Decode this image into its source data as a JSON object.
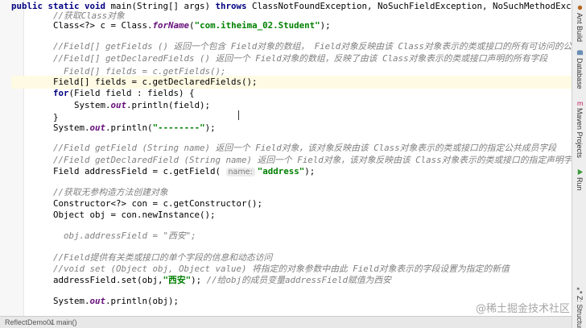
{
  "editor": {
    "lines": [
      {
        "hl": false,
        "indent": "",
        "tokens": [
          {
            "t": "public static void ",
            "c": "kw"
          },
          {
            "t": "main(String[] args) ",
            "c": ""
          },
          {
            "t": "throws ",
            "c": "kw"
          },
          {
            "t": "ClassNotFoundException, NoSuchFieldException, NoSuchMethodExce",
            "c": ""
          }
        ]
      },
      {
        "hl": false,
        "indent": "        ",
        "tokens": [
          {
            "t": "//获取Class对象",
            "c": "cm"
          }
        ]
      },
      {
        "hl": false,
        "indent": "        ",
        "tokens": [
          {
            "t": "Class<?> c = Class.",
            "c": ""
          },
          {
            "t": "forName",
            "c": "st"
          },
          {
            "t": "(",
            "c": ""
          },
          {
            "t": "\"com.itheima_02.Student\"",
            "c": "str"
          },
          {
            "t": ");",
            "c": ""
          }
        ]
      },
      {
        "hl": false,
        "indent": "",
        "tokens": []
      },
      {
        "hl": false,
        "indent": "        ",
        "tokens": [
          {
            "t": "//Field[] getFields () 返回一个包含 Field对象的数组， Field对象反映由该 Class对象表示的类或接口的所有可访问的公共",
            "c": "cm"
          }
        ]
      },
      {
        "hl": false,
        "indent": "        ",
        "tokens": [
          {
            "t": "//Field[] getDeclaredFields () 返回一个 Field对象的数组，反映了由该 Class对象表示的类或接口声明的所有字段",
            "c": "cm"
          }
        ]
      },
      {
        "hl": false,
        "indent": "          ",
        "tokens": [
          {
            "t": "Field[] fields = c.getFields();",
            "c": "cm"
          }
        ]
      },
      {
        "hl": true,
        "indent": "        ",
        "tokens": [
          {
            "t": "Field[] fields = c.getDeclaredFields();",
            "c": ""
          }
        ]
      },
      {
        "hl": false,
        "indent": "        ",
        "tokens": [
          {
            "t": "for",
            "c": "kw"
          },
          {
            "t": "(Field field : fields) {",
            "c": ""
          }
        ]
      },
      {
        "hl": false,
        "indent": "            ",
        "tokens": [
          {
            "t": "System.",
            "c": ""
          },
          {
            "t": "out",
            "c": "st"
          },
          {
            "t": ".println(field);",
            "c": ""
          }
        ]
      },
      {
        "hl": false,
        "indent": "        ",
        "tokens": [
          {
            "t": "}",
            "c": ""
          }
        ]
      },
      {
        "hl": false,
        "indent": "        ",
        "tokens": [
          {
            "t": "System.",
            "c": ""
          },
          {
            "t": "out",
            "c": "st"
          },
          {
            "t": ".println(",
            "c": ""
          },
          {
            "t": "\"--------\"",
            "c": "str"
          },
          {
            "t": ");",
            "c": ""
          }
        ]
      },
      {
        "hl": false,
        "indent": "",
        "tokens": []
      },
      {
        "hl": false,
        "indent": "        ",
        "tokens": [
          {
            "t": "//Field getField (String name) 返回一个 Field对象，该对象反映由该 Class对象表示的类或接口的指定公共成员字段",
            "c": "cm"
          }
        ]
      },
      {
        "hl": false,
        "indent": "        ",
        "tokens": [
          {
            "t": "//Field getDeclaredField (String name) 返回一个 Field对象，该对象反映由该 Class对象表示的类或接口的指定声明字段",
            "c": "cm"
          }
        ]
      },
      {
        "hl": false,
        "indent": "        ",
        "tokens": [
          {
            "t": "Field addressField = c.getField( ",
            "c": ""
          },
          {
            "t": "name:",
            "c": "hint"
          },
          {
            "t": "\"address\"",
            "c": "str"
          },
          {
            "t": ");",
            "c": ""
          }
        ]
      },
      {
        "hl": false,
        "indent": "",
        "tokens": []
      },
      {
        "hl": false,
        "indent": "        ",
        "tokens": [
          {
            "t": "//获取无参构造方法创建对象",
            "c": "cm"
          }
        ]
      },
      {
        "hl": false,
        "indent": "        ",
        "tokens": [
          {
            "t": "Constructor<?> con = c.getConstructor();",
            "c": ""
          }
        ]
      },
      {
        "hl": false,
        "indent": "        ",
        "tokens": [
          {
            "t": "Object obj = con.newInstance();",
            "c": ""
          }
        ]
      },
      {
        "hl": false,
        "indent": "",
        "tokens": []
      },
      {
        "hl": false,
        "indent": "          ",
        "tokens": [
          {
            "t": "obj.addressField = \"西安\";",
            "c": "cm"
          }
        ]
      },
      {
        "hl": false,
        "indent": "",
        "tokens": []
      },
      {
        "hl": false,
        "indent": "        ",
        "tokens": [
          {
            "t": "//Field提供有关类或接口的单个字段的信息和动态访问",
            "c": "cm"
          }
        ]
      },
      {
        "hl": false,
        "indent": "        ",
        "tokens": [
          {
            "t": "//void set (Object obj, Object value) 将指定的对象参数中由此 Field对象表示的字段设置为指定的新值",
            "c": "cm"
          }
        ]
      },
      {
        "hl": false,
        "indent": "        ",
        "tokens": [
          {
            "t": "addressField.set(obj,",
            "c": ""
          },
          {
            "t": "\"西安\"",
            "c": "str"
          },
          {
            "t": "); ",
            "c": ""
          },
          {
            "t": "//给obj的成员变量addressField赋值为西安",
            "c": "cm"
          }
        ]
      },
      {
        "hl": false,
        "indent": "",
        "tokens": []
      },
      {
        "hl": false,
        "indent": "        ",
        "tokens": [
          {
            "t": "System.",
            "c": ""
          },
          {
            "t": "out",
            "c": "st"
          },
          {
            "t": ".println(obj);",
            "c": ""
          }
        ]
      }
    ]
  },
  "right_bar": {
    "tabs": [
      {
        "label": "Ant Build",
        "icon": "ant-icon"
      },
      {
        "label": "Database",
        "icon": "database-icon"
      },
      {
        "label": "Maven Projects",
        "icon": "maven-icon"
      },
      {
        "label": "Run",
        "icon": "run-icon"
      },
      {
        "label": "Z: Structure",
        "icon": "structure-icon"
      }
    ]
  },
  "status_bar": {
    "crumb1": "ReflectDemo01",
    "crumb_sep": "›",
    "crumb2": "main()"
  },
  "watermark": "@稀土掘金技术社区",
  "colors": {
    "keyword": "#000080",
    "string": "#008000",
    "comment": "#808080",
    "static_field": "#660e7a",
    "line_highlight": "#fffae3"
  }
}
